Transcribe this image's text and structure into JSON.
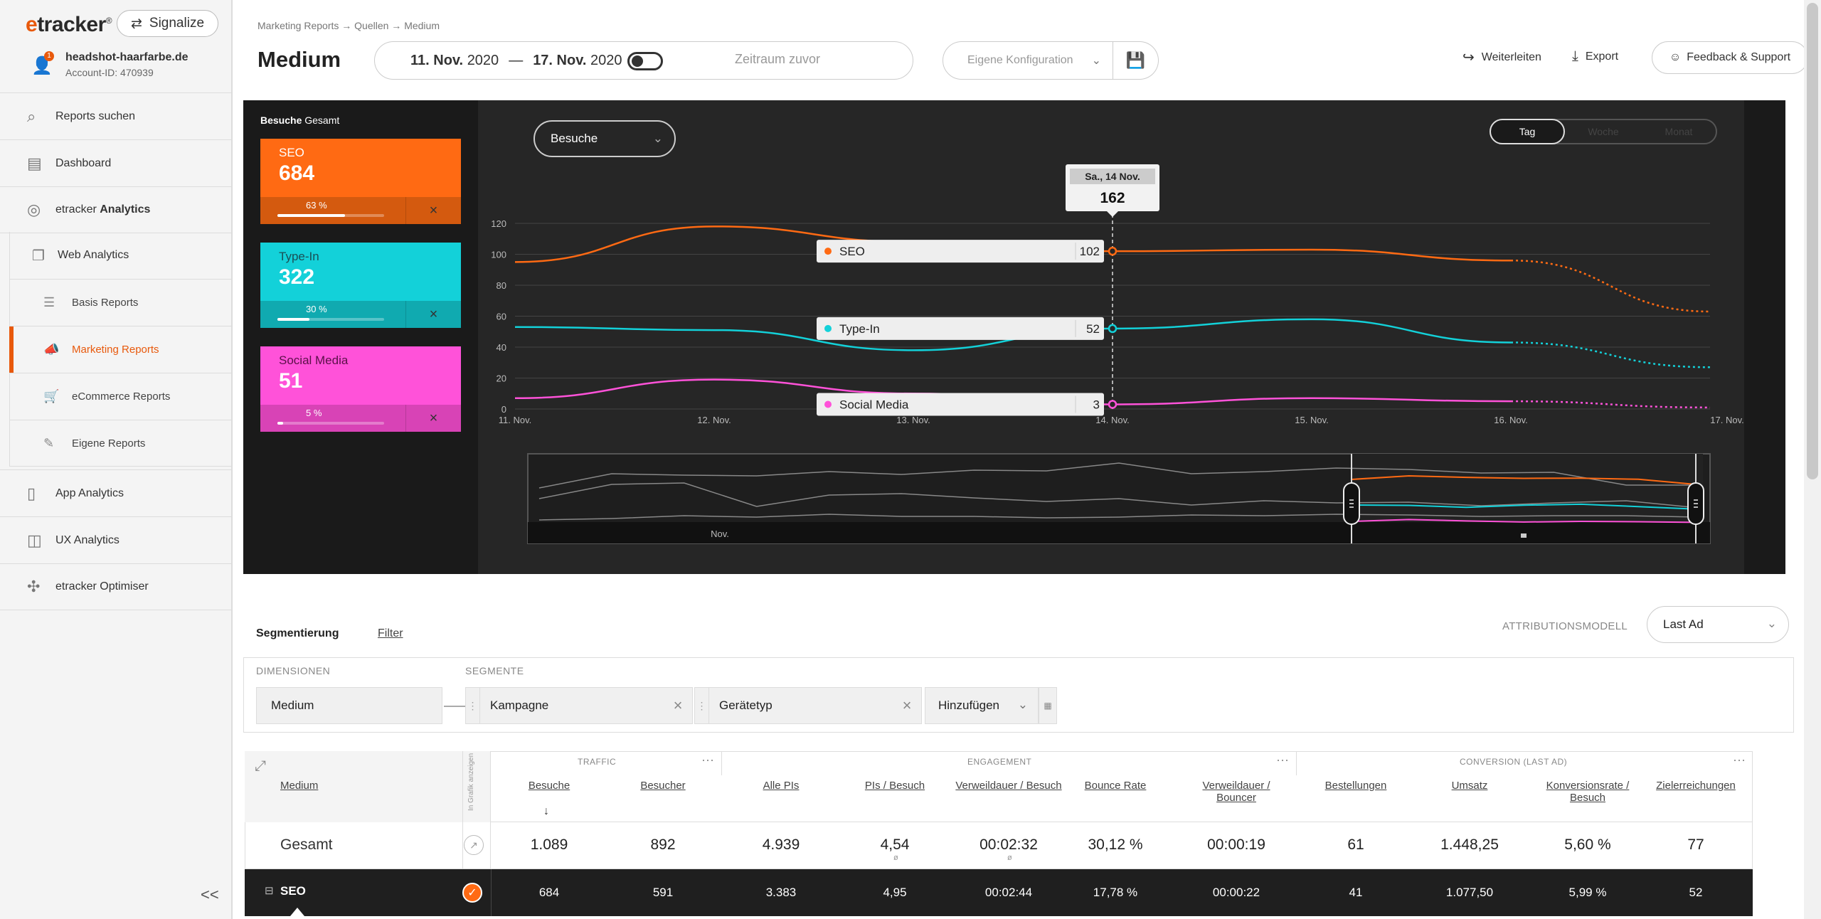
{
  "sidebar": {
    "logo": {
      "e": "e",
      "rest": "tracker",
      "reg": "®"
    },
    "signalize": "Signalize",
    "account": {
      "badge": "1",
      "site": "headshot-haarfarbe.de",
      "id": "Account-ID: 470939"
    },
    "search": "Reports suchen",
    "dashboard": "Dashboard",
    "etracker_analytics": {
      "pre": "etracker ",
      "bold": "Analytics"
    },
    "web_analytics": "Web Analytics",
    "basis": "Basis Reports",
    "marketing": "Marketing Reports",
    "ecommerce": "eCommerce Reports",
    "eigene": "Eigene Reports",
    "app": "App Analytics",
    "ux": "UX Analytics",
    "optimiser": "etracker Optimiser",
    "collapse": "<<"
  },
  "header": {
    "breadcrumb": "Marketing Reports → Quellen → Medium",
    "title": "Medium",
    "date_from_day": "11. Nov.",
    "date_from_year": "2020",
    "date_sep": "—",
    "date_to_day": "17. Nov.",
    "date_to_year": "2020",
    "previous_period": "Zeitraum zuvor",
    "config": "Eigene Konfiguration",
    "forward": "Weiterleiten",
    "export": "Export",
    "feedback": "Feedback & Support"
  },
  "cards": {
    "header_bold": "Besuche",
    "header_rest": "Gesamt",
    "items": [
      {
        "name": "SEO",
        "value": "684",
        "pct": "63 %",
        "pct_value": 0.63,
        "color": "#ff6a13",
        "dark": "#d45a0f",
        "name_color": "#ffffff"
      },
      {
        "name": "Type-In",
        "value": "322",
        "pct": "30 %",
        "pct_value": 0.3,
        "color": "#13d1d9",
        "dark": "#10aab0",
        "name_color": "#1a4f55"
      },
      {
        "name": "Social Media",
        "value": "51",
        "pct": "5 %",
        "pct_value": 0.05,
        "color": "#ff52d9",
        "dark": "#d843b6",
        "name_color": "#5a1048"
      }
    ]
  },
  "chart": {
    "metric": "Besuche",
    "granularity": [
      "Tag",
      "Woche",
      "Monat"
    ],
    "tooltip_date": "Sa., 14 Nov.",
    "tooltip_total": "162",
    "nav_label": "Nov."
  },
  "chart_data": {
    "type": "line",
    "x": [
      "11. Nov.",
      "12. Nov.",
      "13. Nov.",
      "14. Nov.",
      "15. Nov.",
      "16. Nov.",
      "17. Nov."
    ],
    "ylim": [
      0,
      120
    ],
    "yticks": [
      "0",
      "20",
      "40",
      "60",
      "80",
      "100",
      "120"
    ],
    "grid": true,
    "series": [
      {
        "name": "SEO",
        "color": "#ff6a13",
        "values": [
          95,
          118,
          108,
          102,
          103,
          96,
          63
        ],
        "hover": "102"
      },
      {
        "name": "Type-In",
        "color": "#13d1d9",
        "values": [
          53,
          51,
          38,
          52,
          58,
          43,
          27
        ],
        "hover": "52"
      },
      {
        "name": "Social Media",
        "color": "#ff52d9",
        "values": [
          7,
          19,
          10,
          3,
          7,
          5,
          1
        ],
        "hover": "3"
      }
    ]
  },
  "segmentation": {
    "tab_seg": "Segmentierung",
    "tab_filter": "Filter",
    "attr_label": "ATTRIBUTIONSMODELL",
    "attr_value": "Last Ad",
    "dim_label": "DIMENSIONEN",
    "seg_label": "SEGMENTE",
    "dimension": "Medium",
    "segments": [
      "Kampagne",
      "Gerätetyp"
    ],
    "add": "Hinzufügen"
  },
  "table": {
    "medium_header": "Medium",
    "vertical_label": "In Grafik anzeigen",
    "groups": [
      "TRAFFIC",
      "ENGAGEMENT",
      "CONVERSION (LAST AD)"
    ],
    "columns": [
      "Besuche",
      "Besucher",
      "Alle PIs",
      "PIs / Besuch",
      "Verweildauer / Besuch",
      "Bounce Rate",
      "Verweildauer / Bouncer",
      "Bestellungen",
      "Umsatz",
      "Konversionsrate / Besuch",
      "Zielerreichungen"
    ],
    "total_label": "Gesamt",
    "total": [
      "1.089",
      "892",
      "4.939",
      "4,54",
      "00:02:32",
      "30,12 %",
      "00:00:19",
      "61",
      "1.448,25",
      "5,60 %",
      "77"
    ],
    "rows": [
      {
        "name": "SEO",
        "values": [
          "684",
          "591",
          "3.383",
          "4,95",
          "00:02:44",
          "17,78 %",
          "00:00:22",
          "41",
          "1.077,50",
          "5,99 %",
          "52"
        ]
      }
    ]
  }
}
